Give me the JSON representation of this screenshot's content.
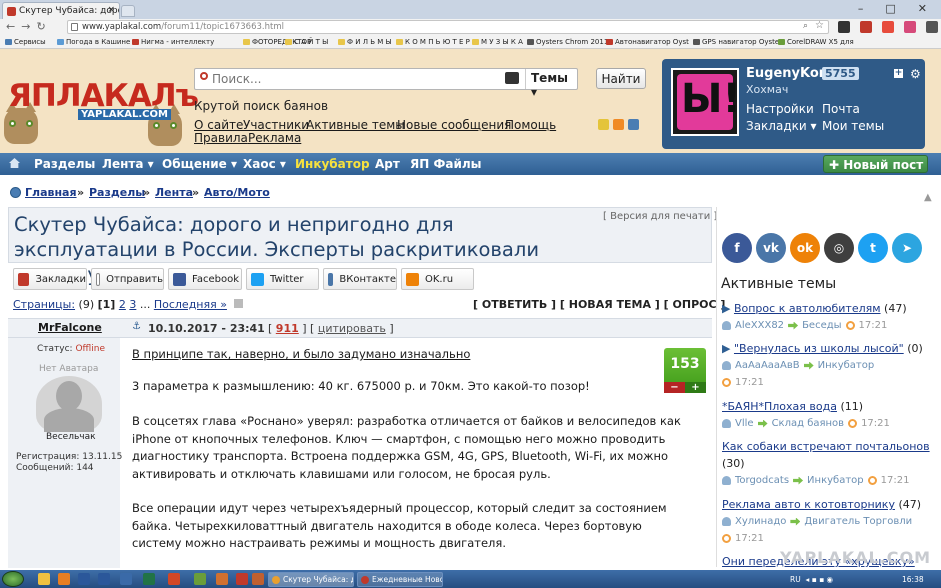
{
  "browser": {
    "tab_title": "Скутер Чубайса: дорого",
    "url_host": "www.yaplakal.com",
    "url_path": "/forum11/topic1673663.html",
    "bookmarks": [
      "Сервисы",
      "Погода в Кашине",
      "Нигма - интеллекту",
      "ФОТОРЕДАКТОР",
      "С А Й Т Ы",
      "Ф И Л Ь М Ы",
      "К О М П Ь Ю Т Е Р",
      "М У З Ы К А",
      "Oysters Chrom 2011",
      "Автонавигатор Oyst",
      "GPS навигатор Oyste",
      "CorelDRAW X5 для"
    ]
  },
  "site": {
    "logo": "ЯПЛАКАЛъ",
    "logo_sub": "YAPLAKAL.COM",
    "search_placeholder": "Поиск...",
    "search_scope": "Темы",
    "find_button": "Найти",
    "tagline": "Крутой поиск баянов",
    "header_links": [
      "О сайте",
      "Участники",
      "Активные темы",
      "Новые сообщения",
      "Помощь",
      "Правила",
      "Реклама"
    ]
  },
  "user": {
    "name": "EugenyKom",
    "count": "5755",
    "status": "Хохмач",
    "avatar_text": "Ы!",
    "links": [
      "Настройки",
      "Почта",
      "Закладки",
      "Мои темы"
    ]
  },
  "nav": {
    "items": [
      "Разделы",
      "Лента",
      "Общение",
      "Хаос",
      "Инкубатор",
      "Арт",
      "ЯП Файлы"
    ],
    "highlight_color": "#f7e13e",
    "new_post": "Новый пост"
  },
  "breadcrumb": [
    "Главная",
    "Разделы",
    "Лента",
    "Авто/Мото"
  ],
  "topic": {
    "title": "Скутер Чубайса: дорого и непригодно для эксплуатации в России. Эксперты раскритиковали новинку",
    "print_version": "Версия для печати"
  },
  "share": [
    "Закладки",
    "Отправить",
    "Facebook",
    "Twitter",
    "ВКонтакте",
    "OK.ru"
  ],
  "pagination": {
    "label": "Страницы:",
    "count": "(9)",
    "current": "[1]",
    "p2": "2",
    "p3": "3",
    "ellipsis": "...",
    "last": "Последняя »"
  },
  "actions": "[ ОТВЕТИТЬ ] [ НОВАЯ ТЕМА ] [ ОПРОС ]",
  "post": {
    "author": "MrFalcone",
    "date": "10.10.2017 - 23:41",
    "number": "911",
    "quote": "цитировать",
    "status_label": "Статус:",
    "status": "Offline",
    "no_avatar": "Нет Аватара",
    "rank": "Весельчак",
    "registration": "Регистрация: 13.11.15",
    "messages": "Сообщений: 144",
    "rating": "153",
    "heading": "В принципе так, наверно, и было задумано изначально",
    "paragraphs": [
      "3 параметра к размышлению: 40 кг. 675000 р. и 70км. Это какой-то позор!",
      "В соцсетях глава «Роснано» уверял: разработка отличается от байков и велосипедов как iPhone от кнопочных телефонов. Ключ — смартфон, с помощью него можно проводить диагностику транспорта. Встроена поддержка GSM, 4G, GPS, Bluetooth, Wi-Fi, их можно активировать и отключать клавишами или голосом, не бросая руль.",
      "Все операции идут через четырехъядерный процессор, который следит за состоянием байка. Четырехкиловаттный двигатель находится в ободе колеса. Через бортовую систему можно настраивать режимы и мощность двигателя."
    ]
  },
  "sidebar": {
    "social": [
      "f",
      "vk",
      "ok",
      "ig",
      "tw",
      "tg"
    ],
    "active_title": "Активные темы",
    "topics": [
      {
        "title": "Вопрос к автолюбителям",
        "count": "(47)",
        "user": "AleXXX82",
        "section": "Беседы",
        "time": "17:21"
      },
      {
        "title": "\"Вернулась из школы лысой\"",
        "count": "(0)",
        "user": "АаАаАааАвВ",
        "section": "Инкубатор",
        "time": "17:21"
      },
      {
        "title": "*БАЯН*Плохая вода",
        "count": "(11)",
        "user": "Vlle",
        "section": "Склад баянов",
        "time": "17:21"
      },
      {
        "title": "Как собаки встречают почтальонов",
        "count": "(30)",
        "user": "Torgodcats",
        "section": "Инкубатор",
        "time": "17:21"
      },
      {
        "title": "Реклама авто к котовторнику",
        "count": "(47)",
        "user": "Хулинадо",
        "section": "Двигатель Торговли",
        "time": "17:21"
      },
      {
        "title": "Они переделели эту «хрущевку»",
        "count": "",
        "user": "",
        "section": "",
        "time": ""
      }
    ],
    "watermark": "YAPLAKAL.COM"
  },
  "taskbar": {
    "tasks": [
      "Скутер Чубайса: до...",
      "Ежедневные Новости"
    ],
    "lang": "RU",
    "time": "16:38"
  }
}
